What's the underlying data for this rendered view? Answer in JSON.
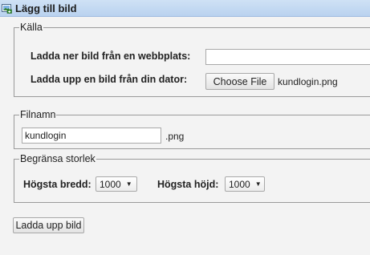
{
  "window": {
    "title": "Lägg till bild",
    "icon": "image-icon"
  },
  "source": {
    "legend": "Källa",
    "download_label": "Ladda ner bild från en webbplats:",
    "url_value": "",
    "upload_label": "Ladda upp en bild från din dator:",
    "choose_file_label": "Choose File",
    "chosen_file": "kundlogin.png"
  },
  "filename": {
    "legend": "Filnamn",
    "value": "kundlogin",
    "extension": ".png"
  },
  "size_limit": {
    "legend": "Begränsa storlek",
    "max_width_label": "Högsta bredd:",
    "max_width_value": "1000",
    "max_height_label": "Högsta höjd:",
    "max_height_value": "1000"
  },
  "actions": {
    "upload_button": "Ladda upp bild"
  }
}
